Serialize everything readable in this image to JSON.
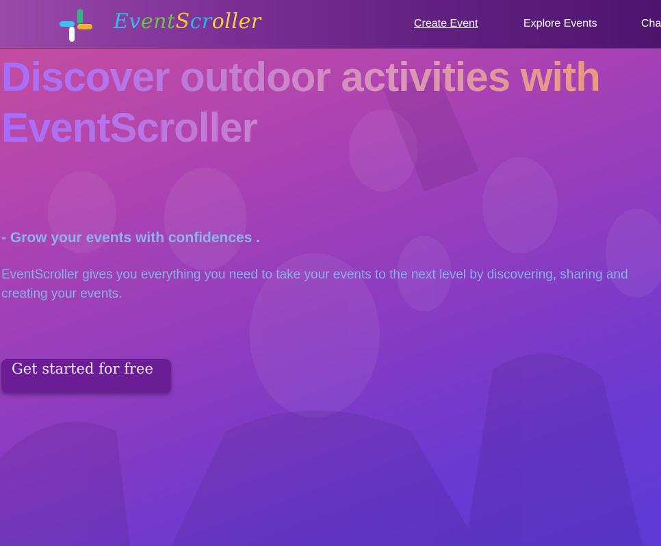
{
  "navbar": {
    "brand": "EventScroller",
    "brand_letter_colors": [
      "#3ab8f0",
      "#3ab8f0",
      "#6ac24a",
      "#6ac24a",
      "#6ac24a",
      "#f2c230",
      "#2fb0e8",
      "#2fb0e8",
      "#f0d23a",
      "#f0d23a",
      "#f0d23a",
      "#f0d23a",
      "#f0d23a"
    ],
    "links": [
      {
        "label": "Create Event",
        "active": true
      },
      {
        "label": "Explore Events"
      },
      {
        "label": "Cha"
      }
    ],
    "logo_icon": "slack-style-hash-logo",
    "logo_colors": [
      "#36c5f0",
      "#2eb67d",
      "#ecb22e",
      "#e01e5a"
    ]
  },
  "hero": {
    "headline": "Discover outdoor activities with EventScroller",
    "tagline": "- Grow your events with confidences .",
    "description": "EventScroller gives you everything you need to take your events to the next level by discovering, sharing and creating your events.",
    "cta_label": "Get started for free"
  },
  "colors": {
    "navbar_bg": "#6a2388",
    "headline_gradient": [
      "#a66cff",
      "#ec9a78"
    ],
    "tagline": "#8fb2ee",
    "cta_bg": "#6a1d95"
  }
}
